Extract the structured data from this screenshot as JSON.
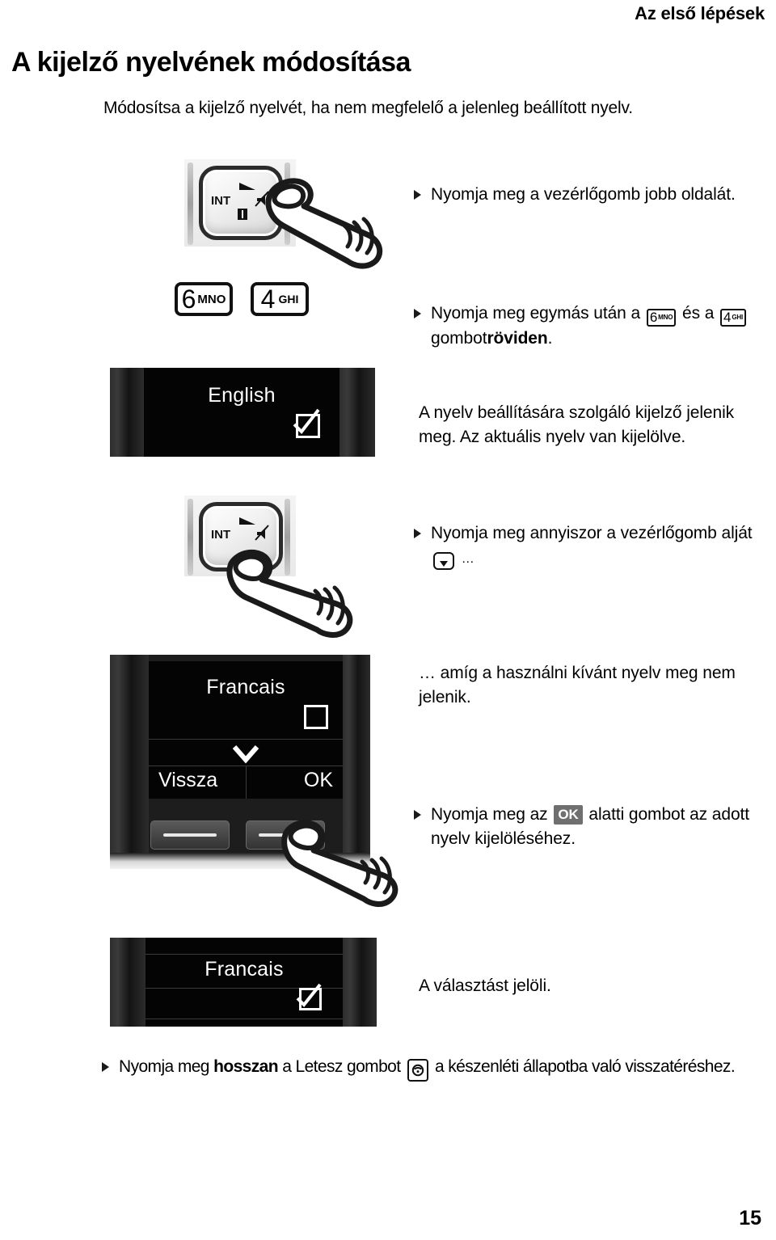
{
  "header": {
    "running_head": "Az első lépések",
    "title": "A kijelző nyelvének módosítása",
    "intro": "Módosítsa a kijelző nyelvét, ha nem megfelelő a jelenleg beállított nyelv."
  },
  "steps": [
    {
      "id": "step-press-right",
      "text_before": "Nyomja meg a vezérlőgomb jobb oldalát.",
      "text_after": ""
    },
    {
      "id": "step-press-6-4",
      "text_before": "Nyomja meg egymás után a",
      "key1_digit": "6",
      "key1_letters": "MNO",
      "text_middle": "és a",
      "key2_digit": "4",
      "key2_letters": "GHI",
      "text_after": "gombot",
      "text_bold": "röviden",
      "text_end": "."
    },
    {
      "id": "step-press-down",
      "text_before": "Nyomja meg annyiszor a vezérlőgomb alját",
      "text_after": "…"
    },
    {
      "id": "step-press-ok",
      "text_before": "Nyomja meg az",
      "badge": "OK",
      "text_after": "alatti gombot az adott nyelv kijelöléséhez."
    },
    {
      "id": "step-press-hangup",
      "text_before": "Nyomja meg",
      "text_bold": "hosszan",
      "text_middle": "a Letesz gombot",
      "text_after": "a készenléti állapotba való visszatéréshez."
    }
  ],
  "notes": [
    {
      "id": "note-language-display",
      "text": "A nyelv beállítására szolgáló kijelző jelenik meg. Az aktuális nyelv van kijelölve."
    },
    {
      "id": "note-until-language",
      "text": "… amíg a használni kívánt nyelv meg nem jelenik."
    },
    {
      "id": "note-selection",
      "text": "A választást  jelöli."
    }
  ],
  "keypad_figure": {
    "int_label": "INT",
    "volume_icon": "volume-icon",
    "directory_icon": "directory-icon",
    "mute_icon": "mute-icon"
  },
  "number_keys": [
    {
      "digit": "6",
      "letters": "MNO"
    },
    {
      "digit": "4",
      "letters": "GHI"
    }
  ],
  "displays": [
    {
      "id": "display-english",
      "language": "English",
      "checkbox": "checked"
    },
    {
      "id": "display-francais-list",
      "language": "Francais",
      "checkbox": "unchecked",
      "scroll_icon": "chevron-down-icon",
      "softkey_left": "Vissza",
      "softkey_right": "OK"
    },
    {
      "id": "display-francais-selected",
      "language": "Francais",
      "checkbox": "checked"
    }
  ],
  "footer": {
    "page_number": "15"
  },
  "colors": {
    "text": "#000000",
    "screen_bg": "#040404",
    "screen_text": "#ffffff",
    "bezel": "#1d1d1d",
    "badge_bg": "#6f6f6f"
  }
}
